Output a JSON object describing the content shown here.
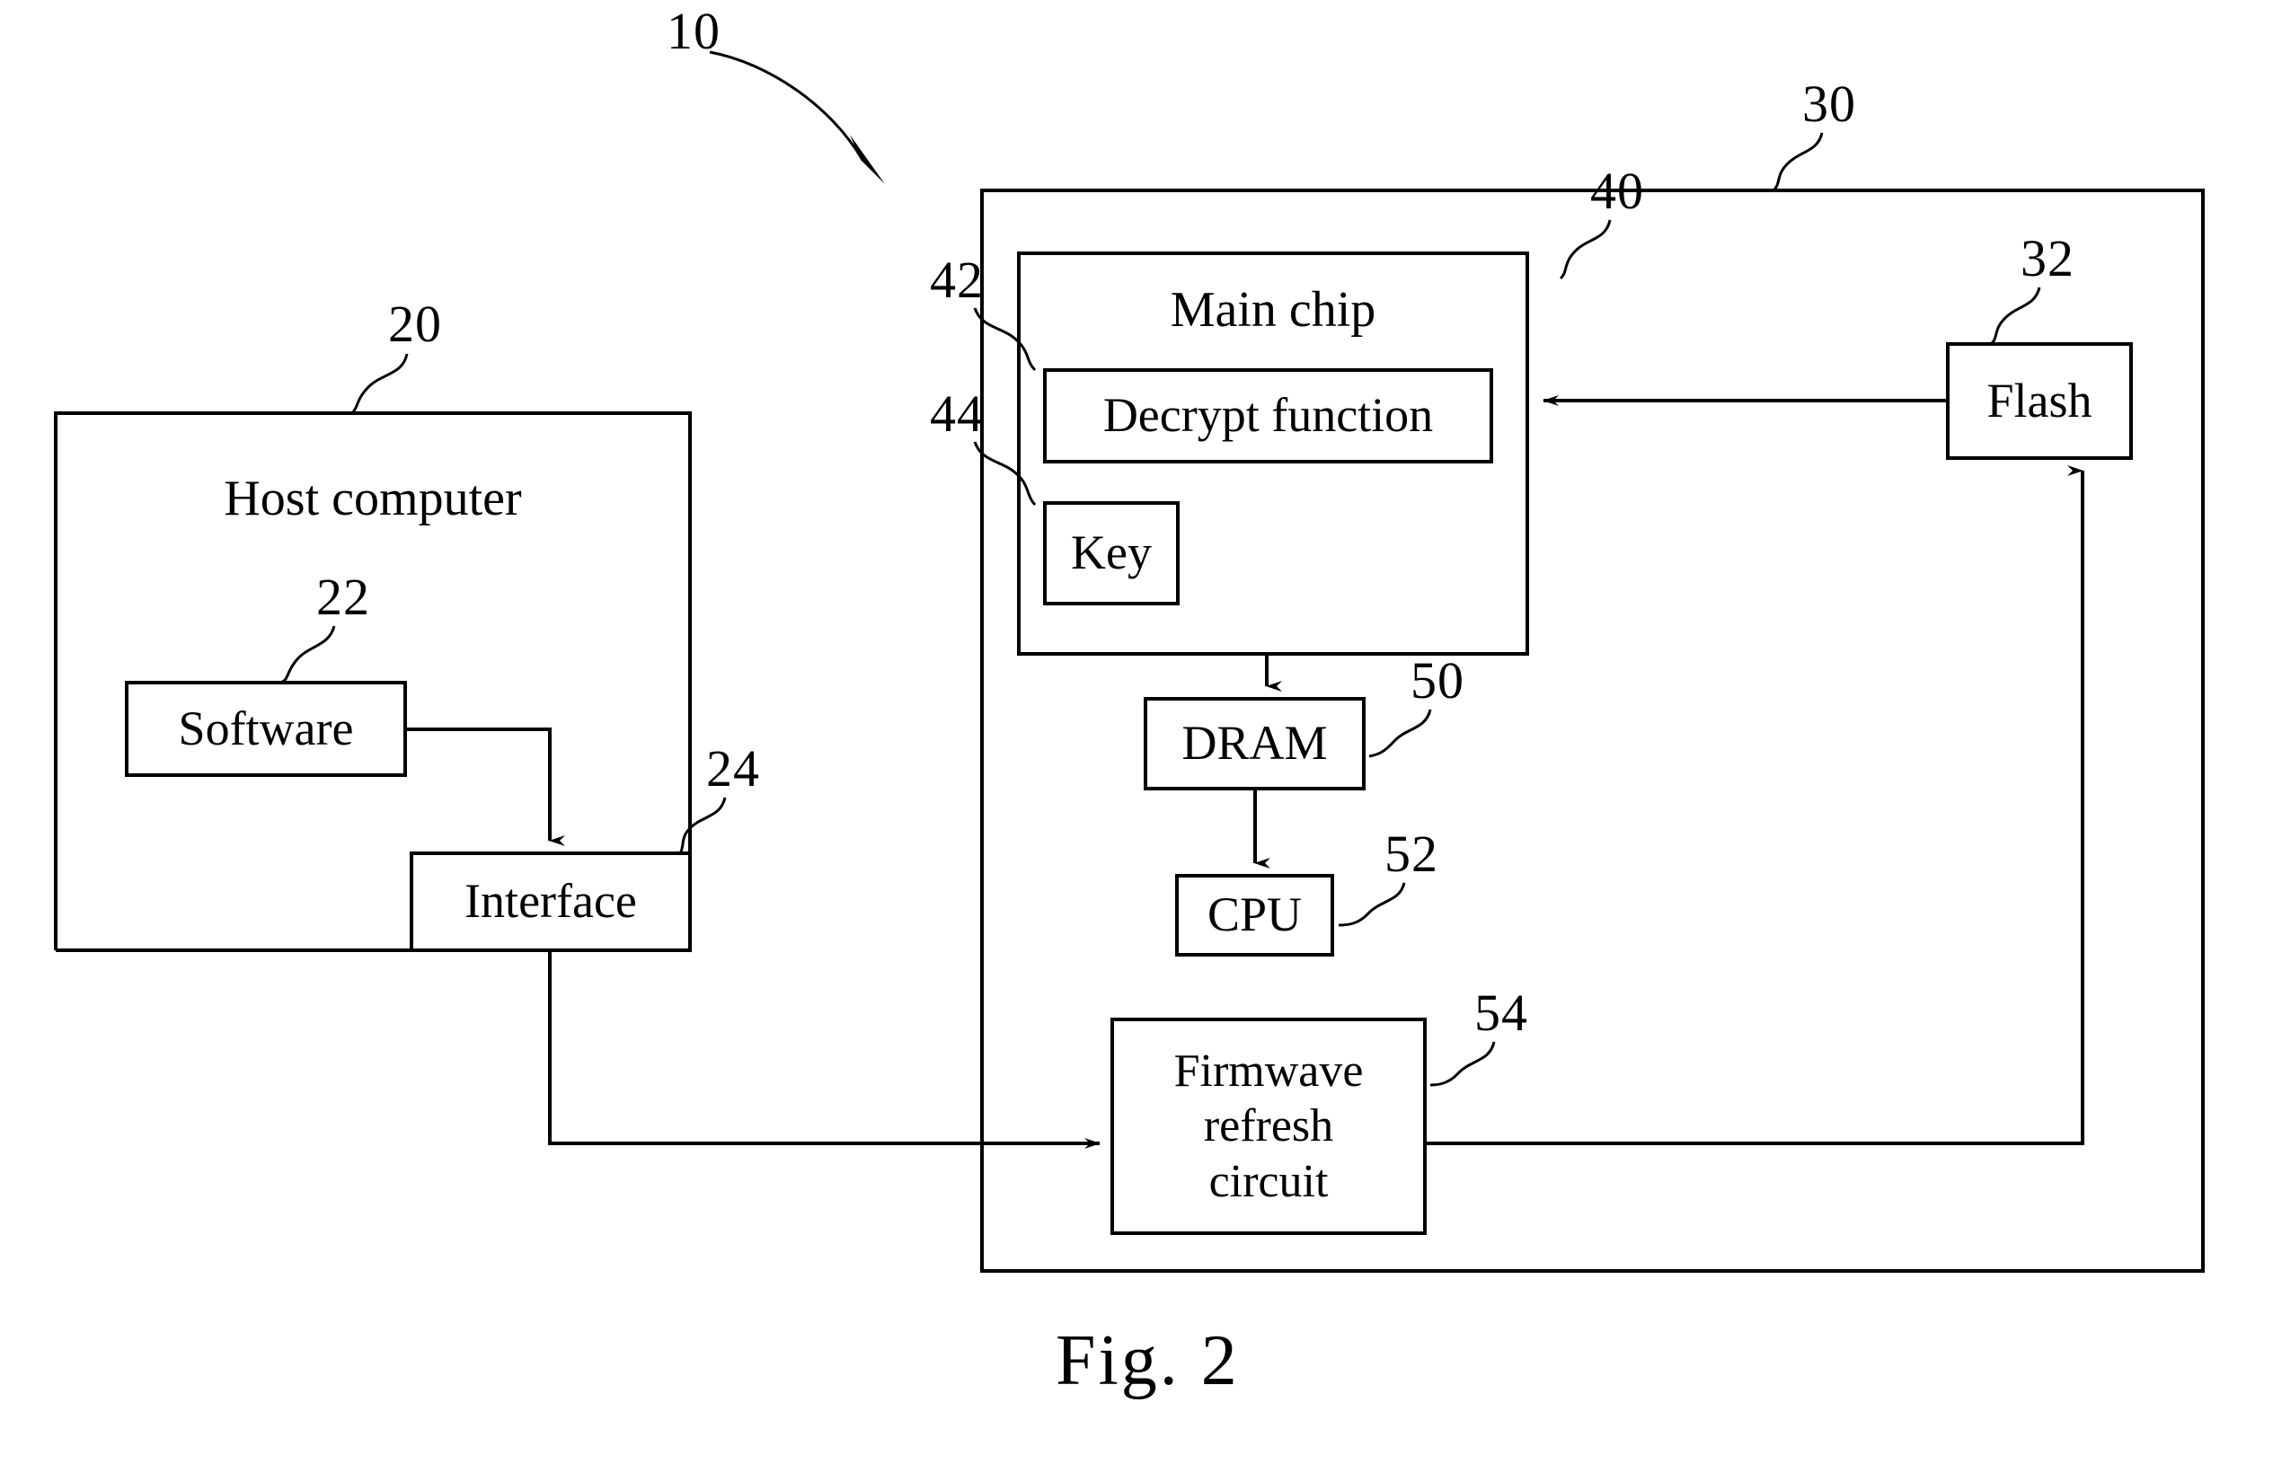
{
  "figure": {
    "caption": "Fig. 2",
    "system_ref": "10"
  },
  "blocks": {
    "host_computer": {
      "label": "Host computer",
      "ref": "20"
    },
    "software": {
      "label": "Software",
      "ref": "22"
    },
    "interface": {
      "label": "Interface",
      "ref": "24"
    },
    "system": {
      "label": "",
      "ref": "30"
    },
    "flash": {
      "label": "Flash",
      "ref": "32"
    },
    "main_chip": {
      "label": "Main chip",
      "ref": "40"
    },
    "decrypt": {
      "label": "Decrypt function",
      "ref": "42"
    },
    "key": {
      "label": "Key",
      "ref": "44"
    },
    "dram": {
      "label": "DRAM",
      "ref": "50"
    },
    "cpu": {
      "label": "CPU",
      "ref": "52"
    },
    "firmware_refresh": {
      "label": "Firmwave\nrefresh\ncircuit",
      "ref": "54"
    }
  },
  "connections": [
    {
      "name": "software-to-interface",
      "from": "Software",
      "to": "Interface",
      "arrow": "down"
    },
    {
      "name": "interface-to-firmware-refresh",
      "from": "Interface",
      "to": "Firmwave refresh circuit",
      "arrow": "right"
    },
    {
      "name": "flash-to-decrypt",
      "from": "Flash",
      "to": "Decrypt function",
      "arrow": "left"
    },
    {
      "name": "main-chip-to-dram",
      "from": "Main chip",
      "to": "DRAM",
      "arrow": "down"
    },
    {
      "name": "dram-to-cpu",
      "from": "DRAM",
      "to": "CPU",
      "arrow": "down"
    },
    {
      "name": "firmware-refresh-to-flash",
      "from": "Firmwave refresh circuit",
      "to": "Flash",
      "arrow": "up"
    }
  ],
  "style": {
    "stroke": "#000000",
    "background": "#ffffff"
  }
}
